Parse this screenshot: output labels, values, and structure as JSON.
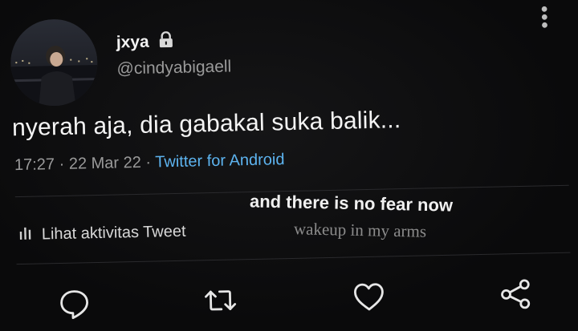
{
  "profile": {
    "display_name": "jxya",
    "handle": "@cindyabigaell",
    "lock_icon": "lock-icon"
  },
  "tweet": {
    "text": "nyerah aja, dia gabakal suka balik...",
    "time": "17:27",
    "date": "22 Mar 22",
    "source": "Twitter for Android"
  },
  "activity": {
    "label": "Lihat aktivitas Tweet",
    "icon": "bar-chart-icon"
  },
  "lyrics": {
    "line1": "and there is no fear now",
    "line2": "wakeup in my arms"
  },
  "actions": {
    "icons": [
      "reply-icon",
      "retweet-icon",
      "like-icon",
      "share-icon"
    ]
  },
  "colors": {
    "background": "#0a0a0b",
    "source_link": "#5db4f0",
    "muted": "#9a9a9a"
  }
}
